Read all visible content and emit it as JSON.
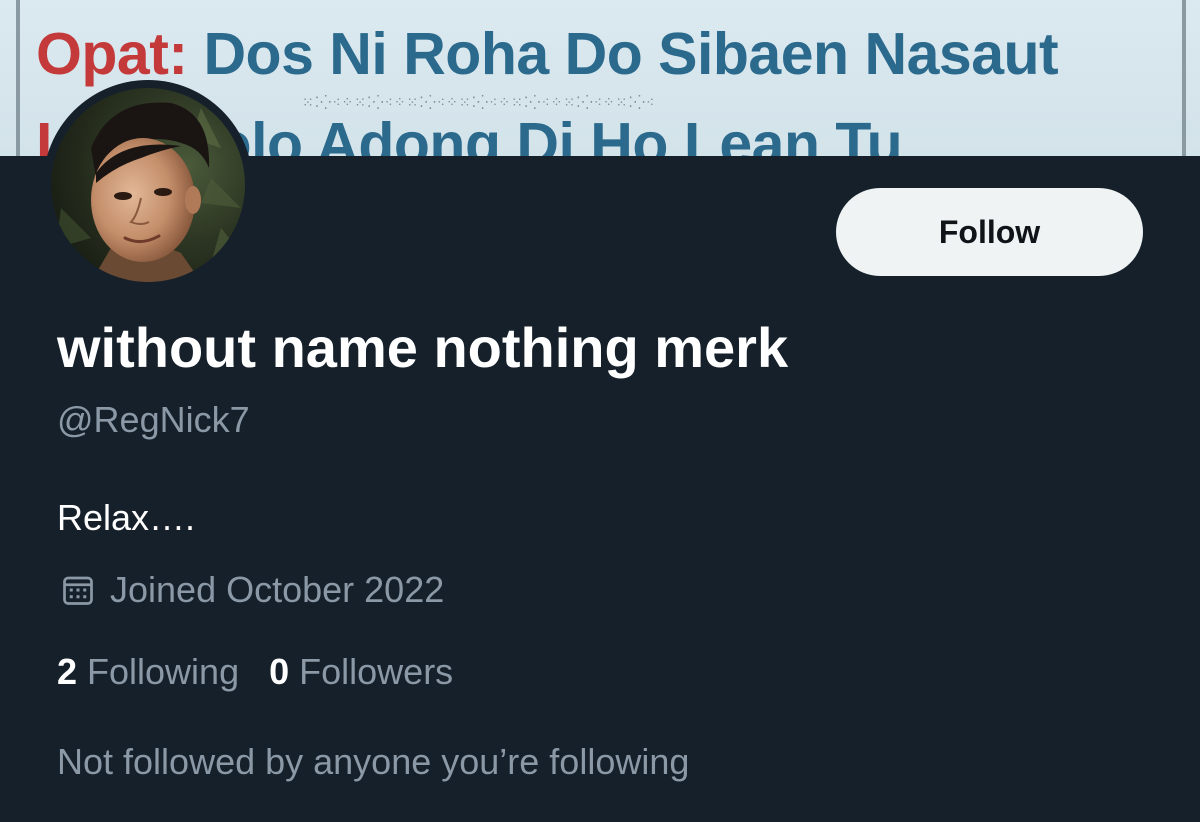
{
  "banner": {
    "line1_lead": "Opat:",
    "line1_rest": "Dos Ni Roha Do Sibaen Nasaut",
    "line2_lead": "L",
    "line2_rest": "Molo Adong Di Ho Lean Tu"
  },
  "profile": {
    "display_name": "without name nothing merk",
    "handle": "@RegNick7",
    "bio": "Relax….",
    "joined": "Joined October 2022",
    "following_count": "2",
    "following_label": "Following",
    "followers_count": "0",
    "followers_label": "Followers",
    "not_followed_note": "Not followed by anyone you’re following"
  },
  "actions": {
    "follow_label": "Follow"
  },
  "icons": {
    "calendar": "calendar-icon",
    "avatar": "avatar-photo"
  },
  "colors": {
    "background": "#15202b",
    "text_primary": "#ffffff",
    "text_secondary": "#8b98a5",
    "button_bg": "#eff3f4",
    "button_text": "#0f1419"
  }
}
